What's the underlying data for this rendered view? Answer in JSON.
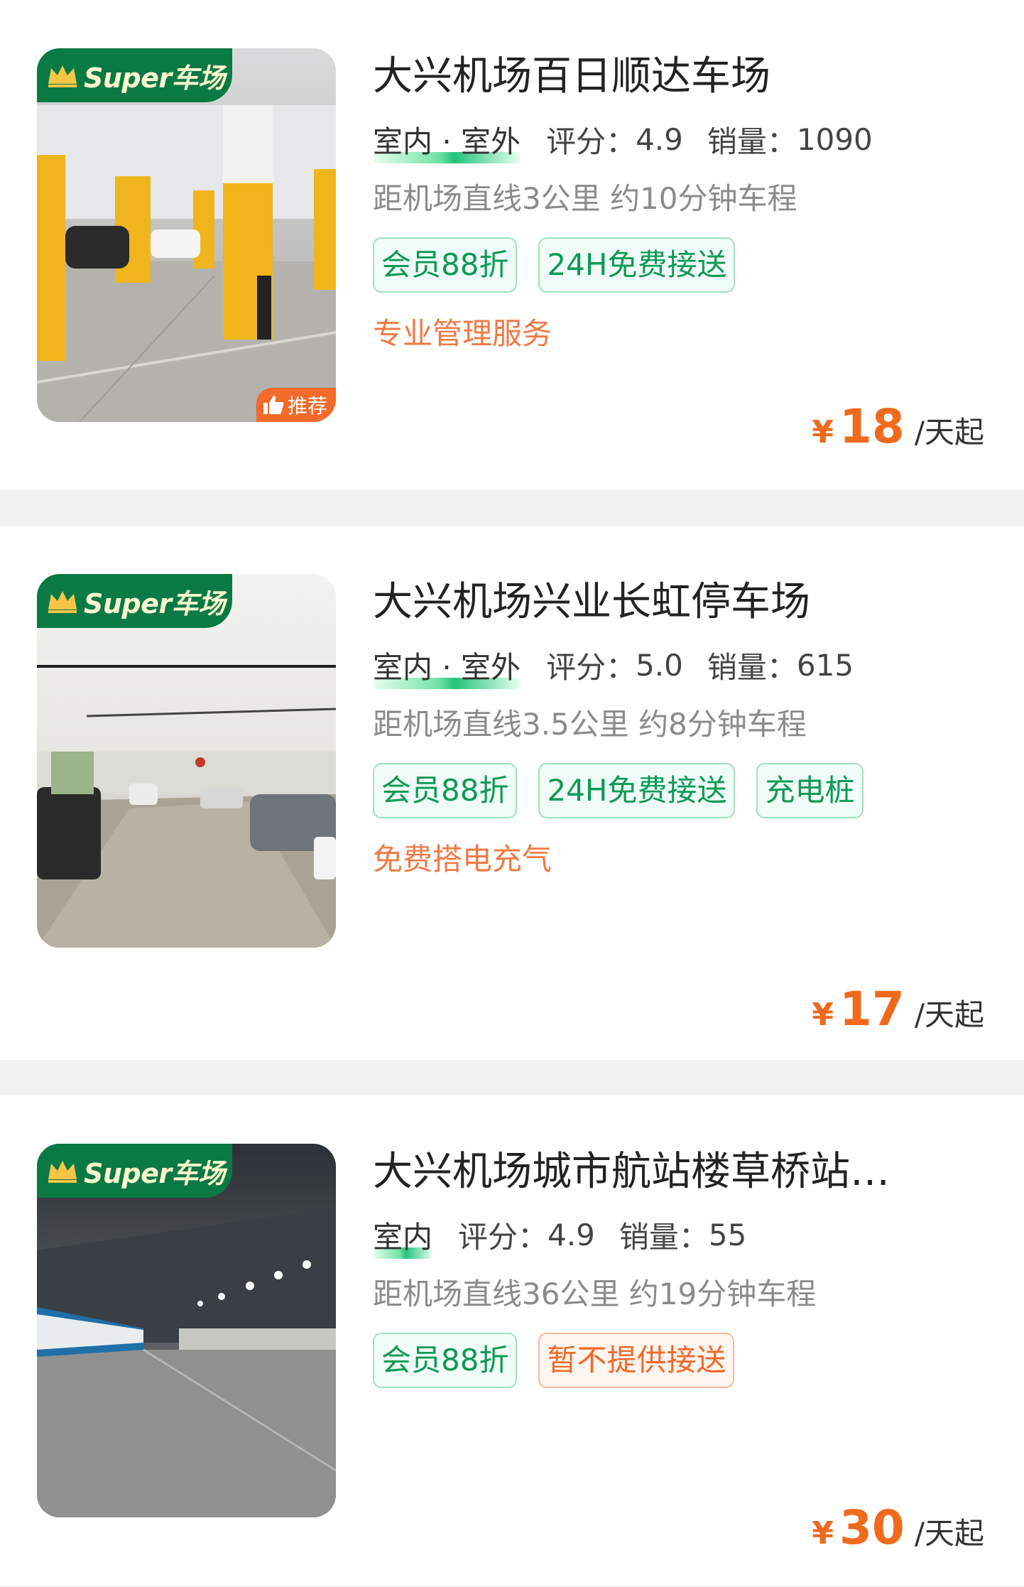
{
  "lots": [
    {
      "badge": "Super车场",
      "recommend": "推荐",
      "title": "大兴机场百日顺达车场",
      "env": "室内 · 室外",
      "rating_label": "评分：",
      "rating": "4.9",
      "sales_label": "销量：",
      "sales": "1090",
      "distance": "距机场直线3公里 约10分钟车程",
      "tags": [
        {
          "text": "会员88折",
          "style": "green"
        },
        {
          "text": "24H免费接送",
          "style": "green"
        }
      ],
      "service": "专业管理服务",
      "price_symbol": "¥",
      "price": "18",
      "price_unit": "/天起"
    },
    {
      "badge": "Super车场",
      "title": "大兴机场兴业长虹停车场",
      "env": "室内 · 室外",
      "rating_label": "评分：",
      "rating": "5.0",
      "sales_label": "销量：",
      "sales": "615",
      "distance": "距机场直线3.5公里 约8分钟车程",
      "tags": [
        {
          "text": "会员88折",
          "style": "green"
        },
        {
          "text": "24H免费接送",
          "style": "green"
        },
        {
          "text": "充电桩",
          "style": "green"
        }
      ],
      "service": "免费搭电充气",
      "price_symbol": "¥",
      "price": "17",
      "price_unit": "/天起"
    },
    {
      "badge": "Super车场",
      "title": "大兴机场城市航站楼草桥站…",
      "env": "室内",
      "rating_label": "评分：",
      "rating": "4.9",
      "sales_label": "销量：",
      "sales": "55",
      "distance": "距机场直线36公里 约19分钟车程",
      "tags": [
        {
          "text": "会员88折",
          "style": "green"
        },
        {
          "text": "暂不提供接送",
          "style": "orange"
        }
      ],
      "service": "",
      "price_symbol": "¥",
      "price": "30",
      "price_unit": "/天起"
    }
  ],
  "colors": {
    "brand_green": "#0a7a45",
    "tag_green": "#0b9a55",
    "accent_orange": "#f06a1e",
    "service_orange": "#f07a45"
  },
  "icons": {
    "badge": "crown-icon",
    "recommend": "thumbs-up-icon"
  }
}
